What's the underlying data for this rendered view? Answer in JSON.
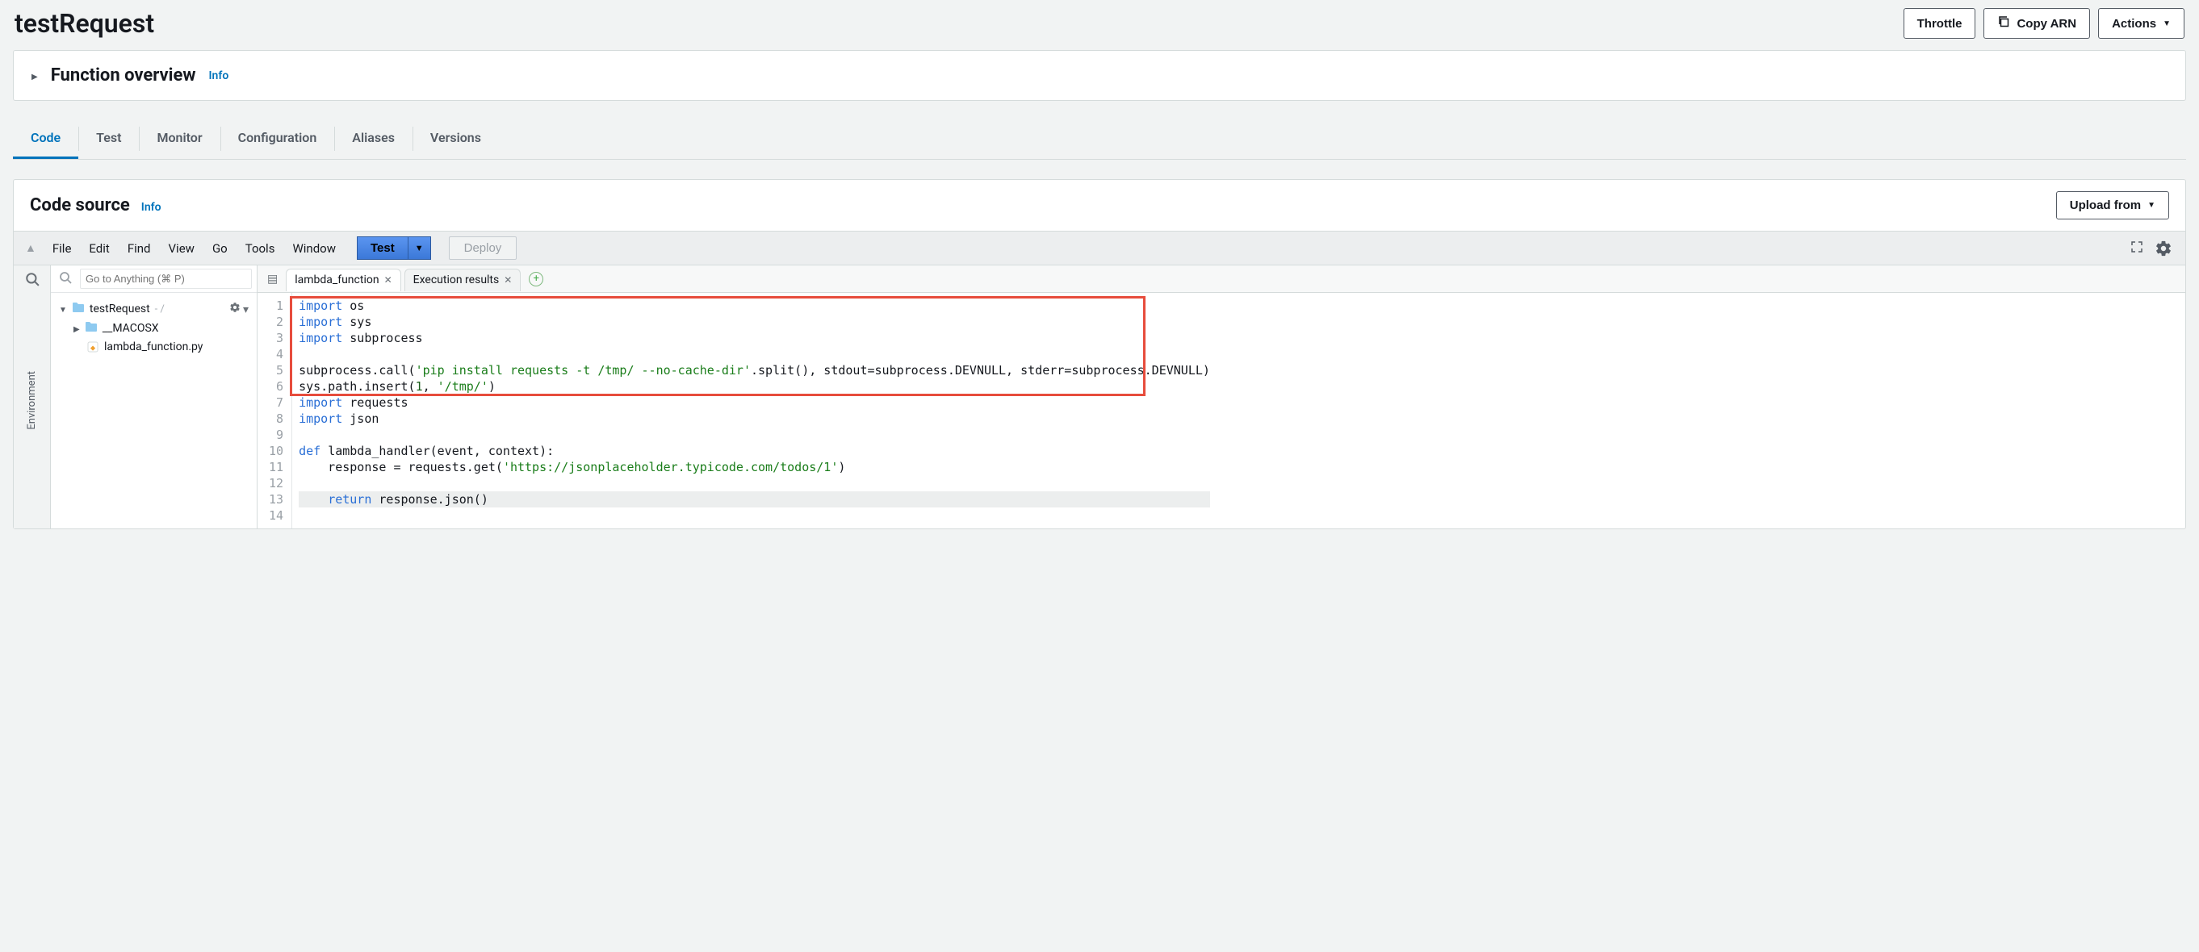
{
  "page": {
    "title": "testRequest"
  },
  "header_actions": {
    "throttle": "Throttle",
    "copy_arn": "Copy ARN",
    "actions": "Actions"
  },
  "overview": {
    "title": "Function overview",
    "info": "Info"
  },
  "tabs": {
    "items": [
      {
        "label": "Code",
        "active": true
      },
      {
        "label": "Test",
        "active": false
      },
      {
        "label": "Monitor",
        "active": false
      },
      {
        "label": "Configuration",
        "active": false
      },
      {
        "label": "Aliases",
        "active": false
      },
      {
        "label": "Versions",
        "active": false
      }
    ]
  },
  "code_source": {
    "title": "Code source",
    "info": "Info",
    "upload_from": "Upload from"
  },
  "editor_menu": {
    "file": "File",
    "edit": "Edit",
    "find": "Find",
    "view": "View",
    "go": "Go",
    "tools": "Tools",
    "window": "Window",
    "test": "Test",
    "deploy": "Deploy"
  },
  "side_rail": {
    "label": "Environment"
  },
  "explorer": {
    "search_placeholder": "Go to Anything (⌘ P)",
    "root": "testRequest",
    "root_suffix": "- /",
    "children": [
      {
        "type": "folder",
        "name": "__MACOSX"
      },
      {
        "type": "file",
        "name": "lambda_function.py"
      }
    ]
  },
  "editor_tabs": {
    "active": {
      "name": "lambda_function"
    },
    "inactive": {
      "name": "Execution results"
    }
  },
  "code": {
    "lines": [
      {
        "n": 1,
        "tokens": [
          {
            "t": "import ",
            "c": "kw"
          },
          {
            "t": "os",
            "c": "obj"
          }
        ]
      },
      {
        "n": 2,
        "tokens": [
          {
            "t": "import ",
            "c": "kw"
          },
          {
            "t": "sys",
            "c": "obj"
          }
        ]
      },
      {
        "n": 3,
        "tokens": [
          {
            "t": "import ",
            "c": "kw"
          },
          {
            "t": "subprocess",
            "c": "obj"
          }
        ]
      },
      {
        "n": 4,
        "tokens": []
      },
      {
        "n": 5,
        "tokens": [
          {
            "t": "subprocess",
            "c": "obj"
          },
          {
            "t": ".call(",
            "c": "obj"
          },
          {
            "t": "'pip install requests -t /tmp/ --no-cache-dir'",
            "c": "str"
          },
          {
            "t": ".split(), stdout=subprocess.DEVNULL, stderr=subprocess.DEVNULL)",
            "c": "obj"
          }
        ]
      },
      {
        "n": 6,
        "tokens": [
          {
            "t": "sys",
            "c": "obj"
          },
          {
            "t": ".path.insert(",
            "c": "obj"
          },
          {
            "t": "1",
            "c": "num"
          },
          {
            "t": ", ",
            "c": "obj"
          },
          {
            "t": "'/tmp/'",
            "c": "str"
          },
          {
            "t": ")",
            "c": "obj"
          }
        ]
      },
      {
        "n": 7,
        "tokens": [
          {
            "t": "import ",
            "c": "kw"
          },
          {
            "t": "requests",
            "c": "obj"
          }
        ]
      },
      {
        "n": 8,
        "tokens": [
          {
            "t": "import ",
            "c": "kw"
          },
          {
            "t": "json",
            "c": "obj"
          }
        ]
      },
      {
        "n": 9,
        "tokens": []
      },
      {
        "n": 10,
        "tokens": [
          {
            "t": "def ",
            "c": "def"
          },
          {
            "t": "lambda_handler",
            "c": "deffn"
          },
          {
            "t": "(event, context):",
            "c": "obj"
          }
        ]
      },
      {
        "n": 11,
        "tokens": [
          {
            "t": "    response = requests.get(",
            "c": "obj"
          },
          {
            "t": "'https://jsonplaceholder.typicode.com/todos/1'",
            "c": "str"
          },
          {
            "t": ")",
            "c": "obj"
          }
        ]
      },
      {
        "n": 12,
        "tokens": []
      },
      {
        "n": 13,
        "hl": true,
        "tokens": [
          {
            "t": "    ",
            "c": "obj"
          },
          {
            "t": "return ",
            "c": "kw"
          },
          {
            "t": "response.json()",
            "c": "obj"
          }
        ]
      },
      {
        "n": 14,
        "tokens": []
      }
    ],
    "highlight_box": {
      "from_line": 1,
      "to_line": 6
    }
  }
}
